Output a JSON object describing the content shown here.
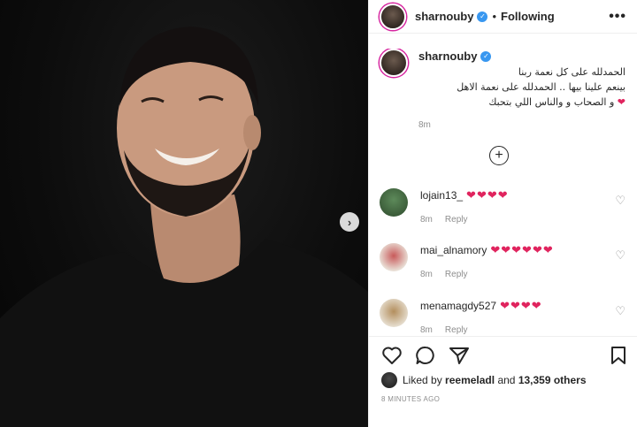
{
  "post": {
    "username": "sharnouby",
    "follow_status": "Following",
    "more_icon": "more-options-icon",
    "caption_line1": "الحمدلله على كل نعمة ربنا",
    "caption_line2": "بينعم علينا بيها .. الحمدلله على نعمة الاهل",
    "caption_line3": "و الصحاب و والناس اللي بتحبك",
    "caption_time": "8m"
  },
  "comments": [
    {
      "user": "lojain13_",
      "hearts": "❤❤❤❤",
      "time": "8m",
      "reply": "Reply"
    },
    {
      "user": "mai_alnamory",
      "hearts": "❤❤❤❤❤❤",
      "time": "8m",
      "reply": "Reply"
    },
    {
      "user": "menamagdy527",
      "hearts": "❤❤❤❤",
      "time": "8m",
      "reply": "Reply"
    }
  ],
  "likes": {
    "prefix": "Liked by",
    "user": "reemeladl",
    "connector": "and",
    "others": "13,359 others"
  },
  "posted_ago": "8 MINUTES AGO",
  "colors": {
    "verified": "#3897f0",
    "heart": "#e0245e",
    "muted": "#8e8e8e"
  }
}
